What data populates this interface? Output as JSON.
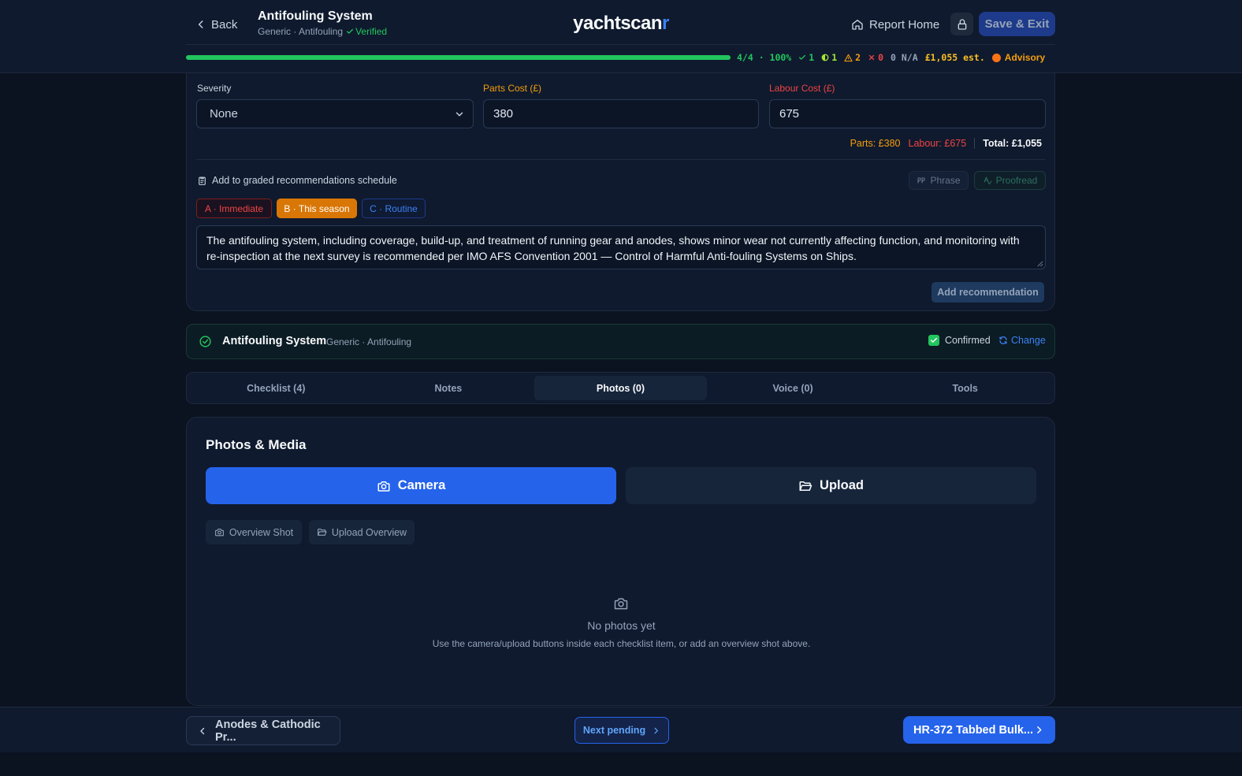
{
  "header": {
    "back_label": "Back",
    "title": "Antifouling System",
    "subtitle": "Generic · Antifouling",
    "verified_label": "Verified",
    "logo_main": "yachtscan",
    "logo_accent": "r",
    "report_home_label": "Report Home",
    "save_exit_label": "Save & Exit"
  },
  "progress": {
    "fraction": 1.0,
    "summary": "4/4 · 100%",
    "ok_count": "1",
    "minor_count": "1",
    "warn_count": "2",
    "fail_count": "0",
    "na_label": "0 N/A",
    "estimate": "£1,055 est.",
    "status_label": "Advisory"
  },
  "costs": {
    "severity_label": "Severity",
    "severity_value": "None",
    "parts_label": "Parts Cost (£)",
    "parts_value": "380",
    "labour_label": "Labour Cost (£)",
    "labour_value": "675",
    "summary_parts": "Parts: £380",
    "summary_labour": "Labour: £675",
    "summary_total": "Total: £1,055"
  },
  "recommendations": {
    "graded_label": "Add to graded recommendations schedule",
    "phrase_label": "Phrase",
    "proofread_label": "Proofread",
    "grade_a": "A · Immediate",
    "grade_b": "B · This season",
    "grade_c": "C · Routine",
    "text": "The antifouling system, including coverage, build-up, and treatment of running gear and anodes, shows minor wear not currently affecting function, and monitoring with re-inspection at the next survey is recommended per IMO AFS Convention 2001 — Control of Harmful Anti-fouling Systems on Ships.",
    "add_button": "Add recommendation"
  },
  "component": {
    "name": "Antifouling System",
    "sub": "Generic · Antifouling",
    "confirmed_label": "Confirmed",
    "change_label": "Change"
  },
  "tabs": [
    {
      "label": "Checklist (4)"
    },
    {
      "label": "Notes"
    },
    {
      "label": "Photos (0)"
    },
    {
      "label": "Voice (0)"
    },
    {
      "label": "Tools"
    }
  ],
  "photos": {
    "title": "Photos & Media",
    "camera_label": "Camera",
    "upload_label": "Upload",
    "overview_shot_label": "Overview Shot",
    "upload_overview_label": "Upload Overview",
    "empty_title": "No photos yet",
    "empty_sub": "Use the camera/upload buttons inside each checklist item, or add an overview shot above."
  },
  "footer": {
    "prev_label": "Anodes & Cathodic Pr...",
    "next_pending_label": "Next pending",
    "next_label": "HR-372 Tabbed Bulk..."
  },
  "colors": {
    "accent_blue": "#2563eb",
    "success_green": "#22c55e",
    "warning_amber": "#f59e0b",
    "danger_red": "#ef4444",
    "background": "#0b1220"
  }
}
